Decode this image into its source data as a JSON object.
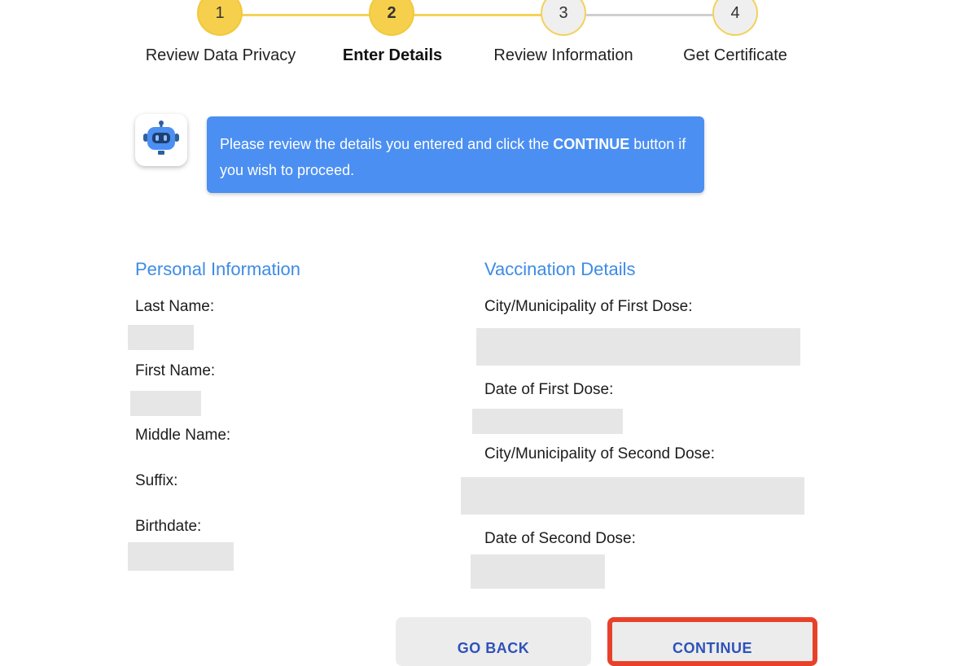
{
  "stepper": {
    "steps": [
      {
        "number": "1",
        "label": "Review Data Privacy",
        "state": "done"
      },
      {
        "number": "2",
        "label": "Enter Details",
        "state": "active"
      },
      {
        "number": "3",
        "label": "Review Information",
        "state": "todo"
      },
      {
        "number": "4",
        "label": "Get Certificate",
        "state": "todo"
      }
    ],
    "colors": {
      "active": "#f6d04d",
      "line_done": "#f2d25a",
      "line_todo": "#cfcfcf"
    }
  },
  "assistant": {
    "icon": "robot-icon",
    "message_prefix": "Please review the details you entered and click the ",
    "message_bold": "CONTINUE",
    "message_suffix": " button if you wish to proceed.",
    "bubble_color": "#4b8ff2"
  },
  "personal": {
    "title": "Personal Information",
    "labels": {
      "last_name": "Last Name:",
      "first_name": "First Name:",
      "middle_name": "Middle Name:",
      "suffix": "Suffix:",
      "birthdate": "Birthdate:"
    }
  },
  "vaccination": {
    "title": "Vaccination Details",
    "labels": {
      "first_city": "City/Municipality of First Dose:",
      "first_date": "Date of First Dose:",
      "second_city": "City/Municipality of Second Dose:",
      "second_date": "Date of Second Dose:"
    }
  },
  "actions": {
    "back_label": "GO BACK",
    "continue_label": "CONTINUE",
    "highlight_color": "#e8412b"
  }
}
